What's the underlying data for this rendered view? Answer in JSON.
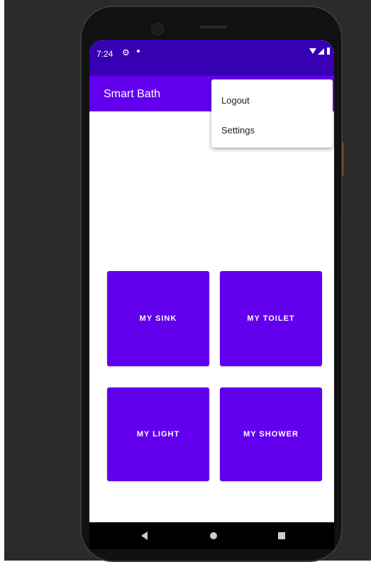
{
  "status_bar": {
    "time": "7:24",
    "gear_icon": "⚙"
  },
  "app_bar": {
    "title": "Smart Bath"
  },
  "overflow_menu": {
    "items": [
      {
        "label": "Logout"
      },
      {
        "label": "Settings"
      }
    ]
  },
  "tiles": [
    {
      "label": "MY SINK"
    },
    {
      "label": "MY TOILET"
    },
    {
      "label": "MY LIGHT"
    },
    {
      "label": "MY SHOWER"
    }
  ],
  "colors": {
    "status_bar": "#3700b3",
    "primary": "#6200ee",
    "tile_text": "#ffffff"
  },
  "nav_bar": {
    "icons": [
      "back-icon",
      "home-icon",
      "recent-apps-icon"
    ]
  }
}
